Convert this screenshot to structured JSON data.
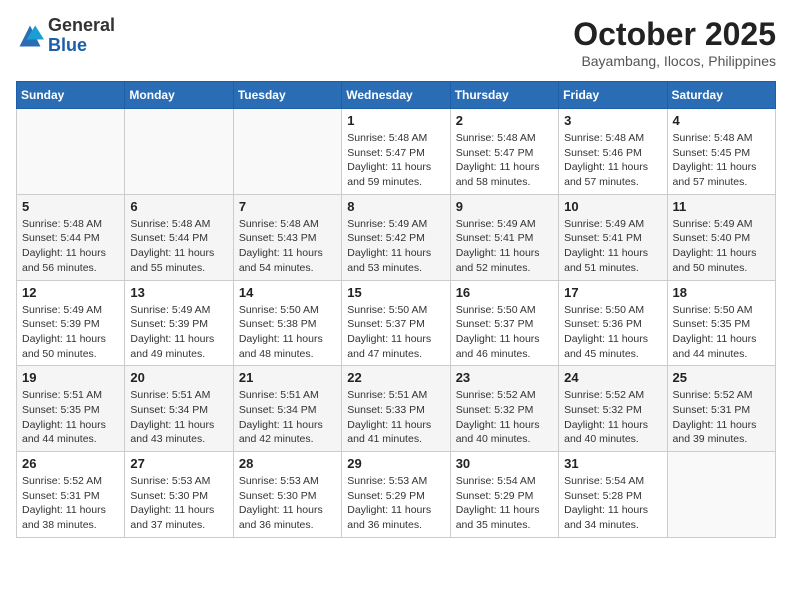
{
  "header": {
    "logo_general": "General",
    "logo_blue": "Blue",
    "month_year": "October 2025",
    "location": "Bayambang, Ilocos, Philippines"
  },
  "days_of_week": [
    "Sunday",
    "Monday",
    "Tuesday",
    "Wednesday",
    "Thursday",
    "Friday",
    "Saturday"
  ],
  "weeks": [
    [
      {
        "day": "",
        "info": ""
      },
      {
        "day": "",
        "info": ""
      },
      {
        "day": "",
        "info": ""
      },
      {
        "day": "1",
        "info": "Sunrise: 5:48 AM\nSunset: 5:47 PM\nDaylight: 11 hours\nand 59 minutes."
      },
      {
        "day": "2",
        "info": "Sunrise: 5:48 AM\nSunset: 5:47 PM\nDaylight: 11 hours\nand 58 minutes."
      },
      {
        "day": "3",
        "info": "Sunrise: 5:48 AM\nSunset: 5:46 PM\nDaylight: 11 hours\nand 57 minutes."
      },
      {
        "day": "4",
        "info": "Sunrise: 5:48 AM\nSunset: 5:45 PM\nDaylight: 11 hours\nand 57 minutes."
      }
    ],
    [
      {
        "day": "5",
        "info": "Sunrise: 5:48 AM\nSunset: 5:44 PM\nDaylight: 11 hours\nand 56 minutes."
      },
      {
        "day": "6",
        "info": "Sunrise: 5:48 AM\nSunset: 5:44 PM\nDaylight: 11 hours\nand 55 minutes."
      },
      {
        "day": "7",
        "info": "Sunrise: 5:48 AM\nSunset: 5:43 PM\nDaylight: 11 hours\nand 54 minutes."
      },
      {
        "day": "8",
        "info": "Sunrise: 5:49 AM\nSunset: 5:42 PM\nDaylight: 11 hours\nand 53 minutes."
      },
      {
        "day": "9",
        "info": "Sunrise: 5:49 AM\nSunset: 5:41 PM\nDaylight: 11 hours\nand 52 minutes."
      },
      {
        "day": "10",
        "info": "Sunrise: 5:49 AM\nSunset: 5:41 PM\nDaylight: 11 hours\nand 51 minutes."
      },
      {
        "day": "11",
        "info": "Sunrise: 5:49 AM\nSunset: 5:40 PM\nDaylight: 11 hours\nand 50 minutes."
      }
    ],
    [
      {
        "day": "12",
        "info": "Sunrise: 5:49 AM\nSunset: 5:39 PM\nDaylight: 11 hours\nand 50 minutes."
      },
      {
        "day": "13",
        "info": "Sunrise: 5:49 AM\nSunset: 5:39 PM\nDaylight: 11 hours\nand 49 minutes."
      },
      {
        "day": "14",
        "info": "Sunrise: 5:50 AM\nSunset: 5:38 PM\nDaylight: 11 hours\nand 48 minutes."
      },
      {
        "day": "15",
        "info": "Sunrise: 5:50 AM\nSunset: 5:37 PM\nDaylight: 11 hours\nand 47 minutes."
      },
      {
        "day": "16",
        "info": "Sunrise: 5:50 AM\nSunset: 5:37 PM\nDaylight: 11 hours\nand 46 minutes."
      },
      {
        "day": "17",
        "info": "Sunrise: 5:50 AM\nSunset: 5:36 PM\nDaylight: 11 hours\nand 45 minutes."
      },
      {
        "day": "18",
        "info": "Sunrise: 5:50 AM\nSunset: 5:35 PM\nDaylight: 11 hours\nand 44 minutes."
      }
    ],
    [
      {
        "day": "19",
        "info": "Sunrise: 5:51 AM\nSunset: 5:35 PM\nDaylight: 11 hours\nand 44 minutes."
      },
      {
        "day": "20",
        "info": "Sunrise: 5:51 AM\nSunset: 5:34 PM\nDaylight: 11 hours\nand 43 minutes."
      },
      {
        "day": "21",
        "info": "Sunrise: 5:51 AM\nSunset: 5:34 PM\nDaylight: 11 hours\nand 42 minutes."
      },
      {
        "day": "22",
        "info": "Sunrise: 5:51 AM\nSunset: 5:33 PM\nDaylight: 11 hours\nand 41 minutes."
      },
      {
        "day": "23",
        "info": "Sunrise: 5:52 AM\nSunset: 5:32 PM\nDaylight: 11 hours\nand 40 minutes."
      },
      {
        "day": "24",
        "info": "Sunrise: 5:52 AM\nSunset: 5:32 PM\nDaylight: 11 hours\nand 40 minutes."
      },
      {
        "day": "25",
        "info": "Sunrise: 5:52 AM\nSunset: 5:31 PM\nDaylight: 11 hours\nand 39 minutes."
      }
    ],
    [
      {
        "day": "26",
        "info": "Sunrise: 5:52 AM\nSunset: 5:31 PM\nDaylight: 11 hours\nand 38 minutes."
      },
      {
        "day": "27",
        "info": "Sunrise: 5:53 AM\nSunset: 5:30 PM\nDaylight: 11 hours\nand 37 minutes."
      },
      {
        "day": "28",
        "info": "Sunrise: 5:53 AM\nSunset: 5:30 PM\nDaylight: 11 hours\nand 36 minutes."
      },
      {
        "day": "29",
        "info": "Sunrise: 5:53 AM\nSunset: 5:29 PM\nDaylight: 11 hours\nand 36 minutes."
      },
      {
        "day": "30",
        "info": "Sunrise: 5:54 AM\nSunset: 5:29 PM\nDaylight: 11 hours\nand 35 minutes."
      },
      {
        "day": "31",
        "info": "Sunrise: 5:54 AM\nSunset: 5:28 PM\nDaylight: 11 hours\nand 34 minutes."
      },
      {
        "day": "",
        "info": ""
      }
    ]
  ]
}
